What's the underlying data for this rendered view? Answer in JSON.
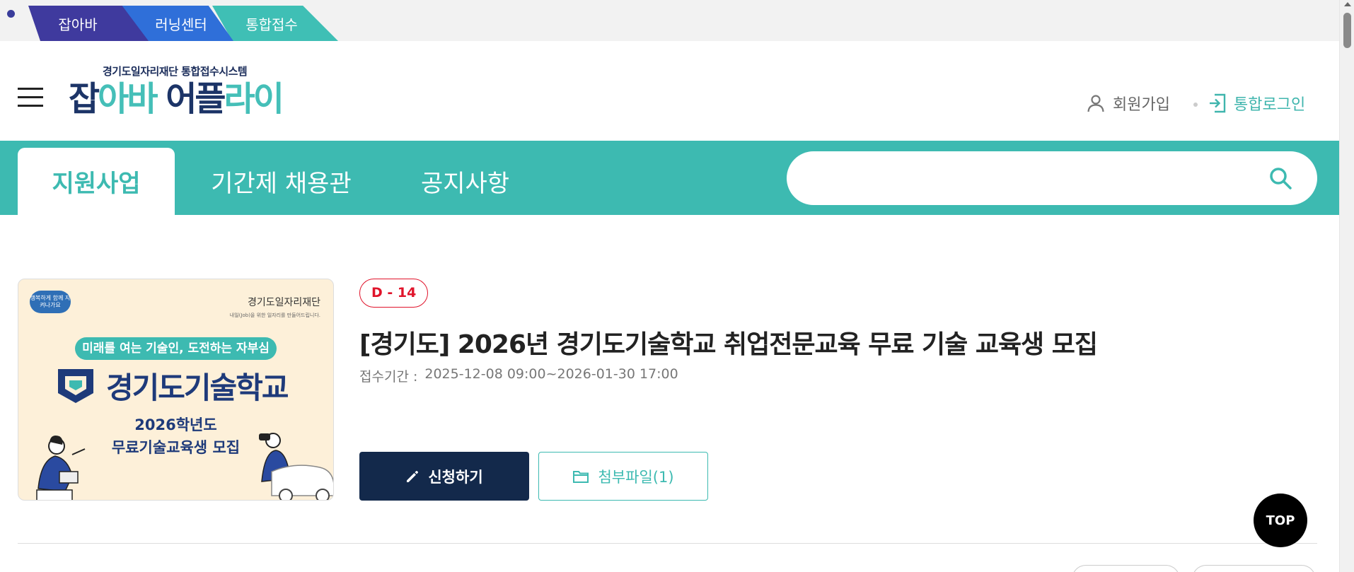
{
  "site_tabs": [
    "잡아바",
    "러닝센터",
    "통합접수"
  ],
  "logo": {
    "subtitle": "경기도일자리재단 통합접수시스템",
    "part1": "잡",
    "part2": "아바 ",
    "part3": "어플",
    "part4": "라이"
  },
  "util": {
    "join": "회원가입",
    "login": "통합로그인"
  },
  "nav": {
    "tabs": [
      "지원사업",
      "기간제 채용관",
      "공지사항"
    ],
    "active": "지원사업",
    "search_value": ""
  },
  "post": {
    "dday": "D - 14",
    "title": "[경기도] 2026년 경기도기술학교 취업전문교육 무료 기술 교육생 모집",
    "period_label": "접수기간 :",
    "period_value": "2025-12-08 09:00~2026-01-30 17:00",
    "apply_label": "신청하기",
    "file_label": "첨부파일(1)"
  },
  "thumbnail": {
    "badge": "행복하게 함께 지켜나가요",
    "foundation": "경기도일자리재단",
    "foundation_sub": "내일(Job)을 위한 일자리를 만들어드립니다.",
    "slogan": "미래를 여는 기술인, 도전하는 자부심",
    "school": "경기도기술학교",
    "line1": "2026학년도",
    "line2": "무료기술교육생 모집"
  },
  "top_button": "TOP",
  "icons": {
    "hamburger": "menu-icon",
    "user": "user-icon",
    "login": "login-icon",
    "search": "search-icon",
    "pencil": "pencil-icon",
    "folder": "folder-icon"
  },
  "colors": {
    "teal": "#3dbab1",
    "navy": "#13294b",
    "red": "#e0142b"
  }
}
